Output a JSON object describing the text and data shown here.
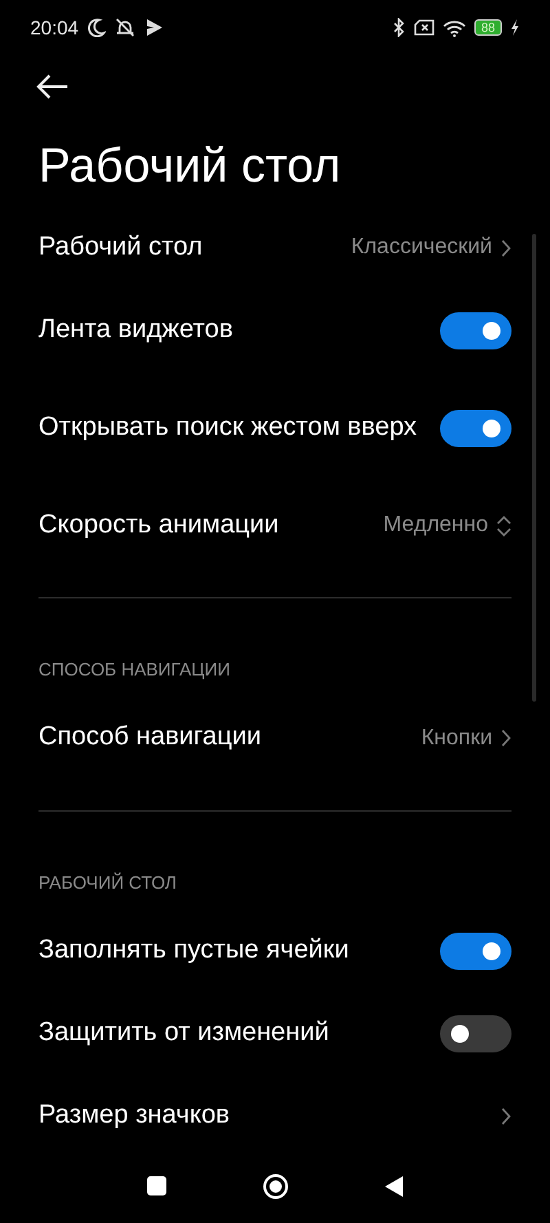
{
  "status_bar": {
    "time": "20:04",
    "battery": "88"
  },
  "title": "Рабочий стол",
  "items": [
    {
      "kind": "link",
      "label": "Рабочий стол",
      "value": "Классический"
    },
    {
      "kind": "toggle",
      "label": "Лента виджетов",
      "on": true
    },
    {
      "kind": "toggle",
      "label": "Открывать поиск жестом вверх",
      "on": true
    },
    {
      "kind": "select",
      "label": "Скорость анимации",
      "value": "Медленно"
    },
    {
      "kind": "divider"
    },
    {
      "kind": "header",
      "label": "СПОСОБ НАВИГАЦИИ"
    },
    {
      "kind": "link",
      "label": "Способ навигации",
      "value": "Кнопки"
    },
    {
      "kind": "divider"
    },
    {
      "kind": "header",
      "label": "РАБОЧИЙ СТОЛ"
    },
    {
      "kind": "toggle",
      "label": "Заполнять пустые ячейки",
      "on": true
    },
    {
      "kind": "toggle",
      "label": "Защитить от изменений",
      "on": false
    },
    {
      "kind": "link",
      "label": "Размер значков"
    }
  ]
}
